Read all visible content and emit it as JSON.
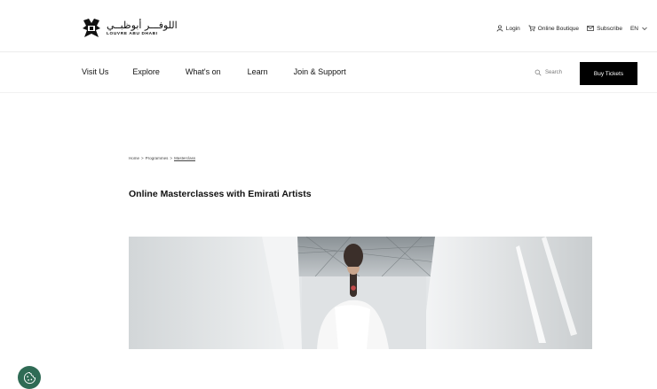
{
  "header": {
    "logo": {
      "arabic": "اللوفـــر أبوظبــي",
      "english": "LOUVRE ABU DHABI",
      "icon": "louvre-logo-icon"
    },
    "utility": {
      "login": "Login",
      "boutique": "Online Boutique",
      "subscribe": "Subscribe",
      "language": "EN"
    }
  },
  "nav": {
    "items": [
      "Visit Us",
      "Explore",
      "What's on",
      "Learn",
      "Join & Support"
    ],
    "search_label": "Search",
    "cta": "Buy Tickets"
  },
  "breadcrumb": [
    "Home",
    "Programmes",
    "Masterclass"
  ],
  "page": {
    "title": "Online Masterclasses with Emirati Artists"
  },
  "colors": {
    "cta_bg": "#000000",
    "cookie_bg": "#2f6b55"
  },
  "icons": {
    "login": "user-icon",
    "boutique": "cart-icon",
    "subscribe": "mail-icon",
    "language": "chevron-down-icon",
    "search": "search-icon",
    "cookie": "cookie-icon"
  }
}
